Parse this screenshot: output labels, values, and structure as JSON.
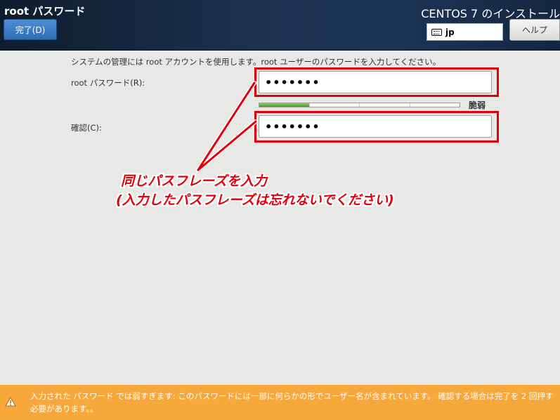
{
  "header": {
    "page_title": "root パスワード",
    "done_label": "完了(D)",
    "install_title": "CENTOS 7 のインストール",
    "keyboard_layout": "jp",
    "help_label": "ヘルプ"
  },
  "form": {
    "intro": "システムの管理には root アカウントを使用します。root ユーザーのパスワードを入力してください。",
    "password_label": "root パスワード(R):",
    "password_value": "•••••••",
    "confirm_label": "確認(C):",
    "confirm_value": "•••••••",
    "strength_text": "脆弱",
    "strength_level": 0.25
  },
  "annotation": {
    "line1": "同じパスフレーズを入力",
    "line2": "(入力したパスフレーズは忘れないでください)",
    "color": "#e3000b"
  },
  "warning": {
    "text": "入力された パスワード では弱すぎます: このパスワードには一部に何らかの形でユーザー名が含まれています。 確認する場合は完了を 2 回押す必要があります。。",
    "color": "#f7a83a"
  }
}
